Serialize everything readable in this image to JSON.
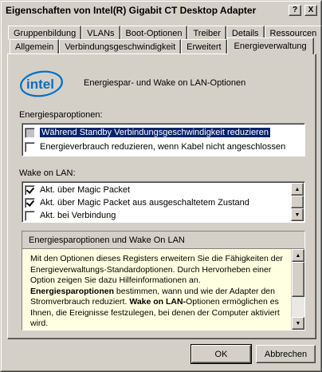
{
  "window": {
    "title": "Eigenschaften von Intel(R) Gigabit CT Desktop Adapter",
    "help_label": "?",
    "close_label": "X"
  },
  "tabs": {
    "row1": [
      "Gruppenbildung",
      "VLANs",
      "Boot-Optionen",
      "Treiber",
      "Details",
      "Ressourcen"
    ],
    "row2": [
      "Allgemein",
      "Verbindungsgeschwindigkeit",
      "Erweitert",
      "Energieverwaltung"
    ],
    "active": "Energieverwaltung"
  },
  "header": {
    "logo_text": "intel",
    "title": "Energiespar- und Wake on LAN-Optionen"
  },
  "energy": {
    "label": "Energiesparoptionen:",
    "items": [
      {
        "label": "Während Standby Verbindungsgeschwindigkeit reduzieren",
        "checked": false,
        "selected": true
      },
      {
        "label": "Energieverbrauch reduzieren, wenn Kabel nicht angeschlossen",
        "checked": false,
        "selected": false
      }
    ]
  },
  "wol": {
    "label": "Wake on LAN:",
    "items": [
      {
        "label": "Akt. über Magic Packet",
        "checked": true
      },
      {
        "label": "Akt. über Magic Packet aus ausgeschaltetem Zustand",
        "checked": true
      },
      {
        "label": "Akt. bei Verbindung",
        "checked": false
      }
    ]
  },
  "info": {
    "title": "Energiesparoptionen und Wake On LAN",
    "p1": "Mit den Optionen dieses Registers erweitern Sie die Fähigkeiten der Energieverwaltungs-Standardoptionen. Durch Hervorheben einer Option zeigen Sie dazu Hilfeinformationen an.",
    "p2_bold": "Energiesparoptionen",
    "p2": " bestimmen, wann und wie der Adapter den Stromverbrauch reduziert. ",
    "p3_bold": "Wake on LAN-",
    "p3": "Optionen ermöglichen es Ihnen, die Ereignisse festzulegen, bei denen der Computer aktiviert wird."
  },
  "buttons": {
    "ok": "OK",
    "cancel": "Abbrechen"
  },
  "colors": {
    "selection": "#0a246a",
    "info_bg": "#ffffe1",
    "intel_blue": "#0071c5"
  }
}
